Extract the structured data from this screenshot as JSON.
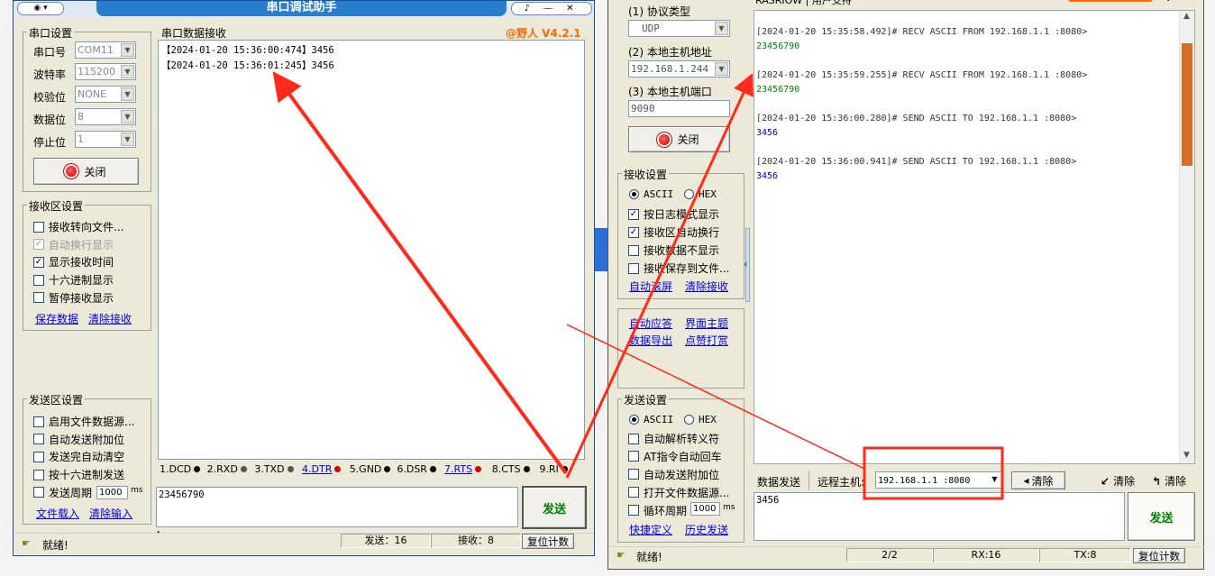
{
  "left_window": {
    "title": "串口调试助手",
    "version": "@野人 V4.2.1",
    "serial_settings": {
      "group_title": "串口设置",
      "port_label": "串口号",
      "port_value": "COM11",
      "baud_label": "波特率",
      "baud_value": "115200",
      "parity_label": "校验位",
      "parity_value": "NONE",
      "databits_label": "数据位",
      "databits_value": "8",
      "stopbits_label": "停止位",
      "stopbits_value": "1",
      "close_button": "关闭"
    },
    "receive_settings": {
      "group_title": "接收区设置",
      "options": [
        {
          "label": "接收转向文件...",
          "checked": false,
          "disabled": false
        },
        {
          "label": "自动换行显示",
          "checked": true,
          "disabled": true
        },
        {
          "label": "显示接收时间",
          "checked": true,
          "disabled": false
        },
        {
          "label": "十六进制显示",
          "checked": false,
          "disabled": false
        },
        {
          "label": "暂停接收显示",
          "checked": false,
          "disabled": false
        }
      ],
      "save_link": "保存数据",
      "clear_link": "清除接收"
    },
    "send_settings": {
      "group_title": "发送区设置",
      "options": [
        {
          "label": "启用文件数据源...",
          "checked": false
        },
        {
          "label": "自动发送附加位",
          "checked": false
        },
        {
          "label": "发送完自动清空",
          "checked": false
        },
        {
          "label": "按十六进制发送",
          "checked": false
        },
        {
          "label": "发送周期",
          "checked": false
        }
      ],
      "period_value": "1000",
      "period_unit": "ms",
      "load_file_link": "文件载入",
      "clear_input_link": "清除输入"
    },
    "receive_area": {
      "title": "串口数据接收",
      "lines": [
        "【2024-01-20 15:36:00:474】3456",
        "【2024-01-20 15:36:01:245】3456"
      ]
    },
    "pin_status": [
      {
        "label": "1.DCD",
        "color": "#000000",
        "link": false
      },
      {
        "label": "2.RXD",
        "color": "#555555",
        "link": false
      },
      {
        "label": "3.TXD",
        "color": "#555555",
        "link": false
      },
      {
        "label": "4.DTR",
        "color": "#d00000",
        "link": true
      },
      {
        "label": "5.GND",
        "color": "#000000",
        "link": false
      },
      {
        "label": "6.DSR",
        "color": "#000000",
        "link": false
      },
      {
        "label": "7.RTS",
        "color": "#d00000",
        "link": true
      },
      {
        "label": "8.CTS",
        "color": "#000000",
        "link": false
      },
      {
        "label": "9.RI",
        "color": "#000000",
        "link": false
      }
    ],
    "send_input": "23456790",
    "send_button": "发送",
    "status": {
      "ready": "就绪!",
      "sent": "发送：16",
      "received": "接收：8",
      "reset": "复位计数"
    }
  },
  "right_window": {
    "top_tab": "RASRIOW | 用户支持",
    "network_settings": {
      "protocol_label": "(1) 协议类型",
      "protocol_value": "UDP",
      "host_label": "(2) 本地主机地址",
      "host_value": "192.168.1.244",
      "port_label": "(3) 本地主机端口",
      "port_value": "9090",
      "close_button": "关闭"
    },
    "receive_settings": {
      "group_title": "接收设置",
      "radio_ascii": "ASCII",
      "radio_hex": "HEX",
      "options": [
        {
          "label": "按日志模式显示",
          "checked": true
        },
        {
          "label": "接收区自动换行",
          "checked": true
        },
        {
          "label": "接收数据不显示",
          "checked": false
        },
        {
          "label": "接收保存到文件...",
          "checked": false
        }
      ],
      "auto_scroll_link": "自动滚屏",
      "clear_link": "清除接收"
    },
    "extra_links": [
      "自动应答",
      "界面主题",
      "数据导出",
      "点赞打赏"
    ],
    "send_settings": {
      "group_title": "发送设置",
      "radio_ascii": "ASCII",
      "radio_hex": "HEX",
      "options": [
        {
          "label": "自动解析转义符",
          "checked": false
        },
        {
          "label": "AT指令自动回车",
          "checked": false
        },
        {
          "label": "自动发送附加位",
          "checked": false
        },
        {
          "label": "打开文件数据源...",
          "checked": false
        },
        {
          "label": "循环周期",
          "checked": false
        }
      ],
      "period_value": "1000",
      "period_unit": "ms",
      "shortcut_link": "快捷定义",
      "history_link": "历史发送"
    },
    "log": [
      {
        "header": "[2024-01-20 15:35:58.492]# RECV ASCII FROM 192.168.1.1 :8080>",
        "data": "23456790",
        "color": "#008000"
      },
      {
        "header": "[2024-01-20 15:35:59.255]# RECV ASCII FROM 192.168.1.1 :8080>",
        "data": "23456790",
        "color": "#008000"
      },
      {
        "header": "[2024-01-20 15:36:00.280]# SEND ASCII TO 192.168.1.1 :8080>",
        "data": "3456",
        "color": "#0000cc"
      },
      {
        "header": "[2024-01-20 15:36:00.941]# SEND ASCII TO 192.168.1.1 :8080>",
        "data": "3456",
        "color": "#0000cc"
      }
    ],
    "send_bar": {
      "data_send_label": "数据发送",
      "remote_host_label": "远程主机:",
      "remote_host_value": "192.168.1.1 :8080",
      "clear_button": "清除",
      "clear2": "清除",
      "clear3": "清除"
    },
    "send_input": "3456",
    "send_button": "发送",
    "status": {
      "ready": "就绪!",
      "page": "2/2",
      "rx": "RX:16",
      "tx": "TX:8",
      "reset": "复位计数"
    }
  },
  "colors": {
    "arrow_red": "#ff2a1a",
    "title_blue": "#2a7ccc",
    "version_orange": "#ff6a00"
  }
}
